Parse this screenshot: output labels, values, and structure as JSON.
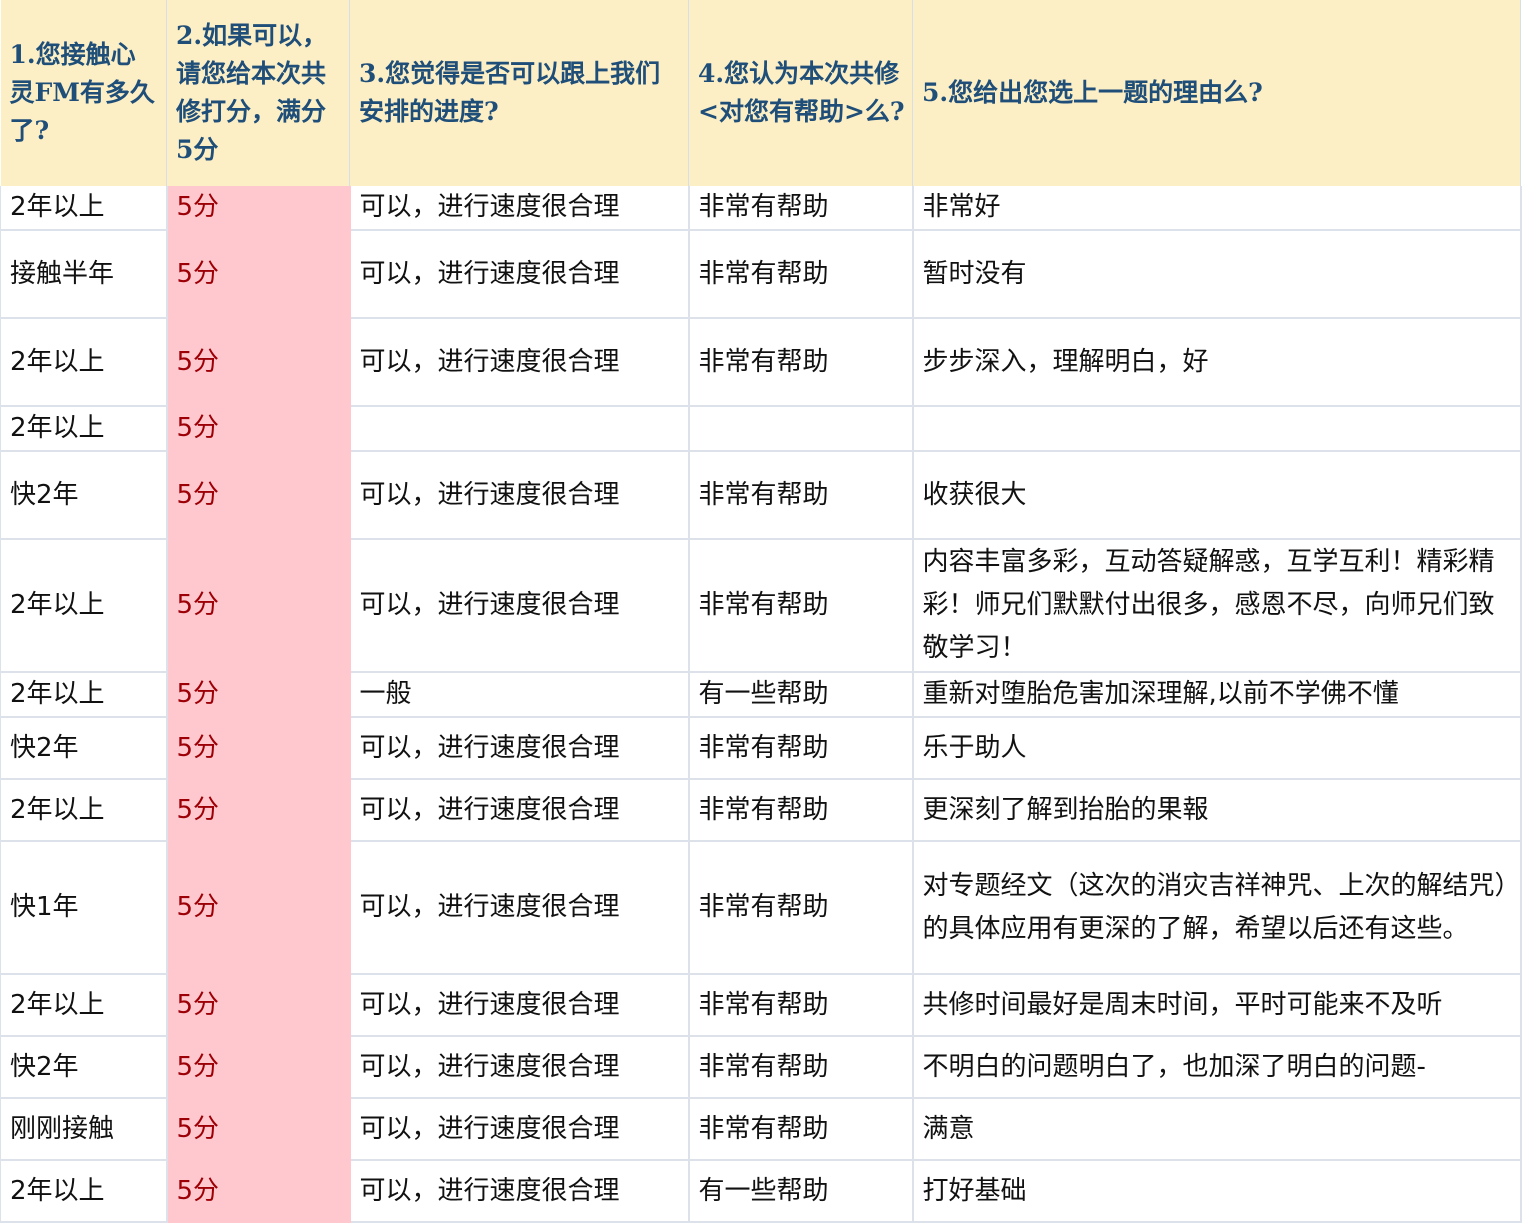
{
  "headers": [
    "1.您接触心灵FM有多久了?",
    "2.如果可以，请您给本次共修打分，满分5分",
    "3.您觉得是否可以跟上我们安排的进度?",
    "4.您认为本次共修<对您有帮助>么?",
    "5.您给出您选上一题的理由么?"
  ],
  "rows": [
    {
      "duration": "2年以上",
      "score": "5分",
      "pace": "可以，进行速度很合理",
      "helpful": "非常有帮助",
      "reason": "非常好"
    },
    {
      "duration": "接触半年",
      "score": "5分",
      "pace": "可以，进行速度很合理",
      "helpful": "非常有帮助",
      "reason": "暂时没有"
    },
    {
      "duration": "2年以上",
      "score": "5分",
      "pace": "可以，进行速度很合理",
      "helpful": "非常有帮助",
      "reason": "步步深入，理解明白，好"
    },
    {
      "duration": "2年以上",
      "score": "5分",
      "pace": "",
      "helpful": "",
      "reason": ""
    },
    {
      "duration": "快2年",
      "score": "5分",
      "pace": "可以，进行速度很合理",
      "helpful": "非常有帮助",
      "reason": "收获很大"
    },
    {
      "duration": "2年以上",
      "score": "5分",
      "pace": "可以，进行速度很合理",
      "helpful": "非常有帮助",
      "reason": "内容丰富多彩，互动答疑解惑，互学互利！精彩精彩！师兄们默默付出很多，感恩不尽，向师兄们致敬学习！"
    },
    {
      "duration": "2年以上",
      "score": "5分",
      "pace": "一般",
      "helpful": "有一些帮助",
      "reason": "重新对堕胎危害加深理解,以前不学佛不懂"
    },
    {
      "duration": "快2年",
      "score": "5分",
      "pace": "可以，进行速度很合理",
      "helpful": "非常有帮助",
      "reason": "乐于助人"
    },
    {
      "duration": "2年以上",
      "score": "5分",
      "pace": "可以，进行速度很合理",
      "helpful": "非常有帮助",
      "reason": "更深刻了解到抬胎的果報"
    },
    {
      "duration": "快1年",
      "score": "5分",
      "pace": "可以，进行速度很合理",
      "helpful": "非常有帮助",
      "reason": "对专题经文（这次的消灾吉祥神咒、上次的解结咒）的具体应用有更深的了解，希望以后还有这些。"
    },
    {
      "duration": "2年以上",
      "score": "5分",
      "pace": "可以，进行速度很合理",
      "helpful": "非常有帮助",
      "reason": "共修时间最好是周末时间，平时可能来不及听"
    },
    {
      "duration": "快2年",
      "score": "5分",
      "pace": "可以，进行速度很合理",
      "helpful": "非常有帮助",
      "reason": "不明白的问题明白了，也加深了明白的问题-"
    },
    {
      "duration": "刚刚接触",
      "score": "5分",
      "pace": "可以，进行速度很合理",
      "helpful": "非常有帮助",
      "reason": "满意"
    },
    {
      "duration": "2年以上",
      "score": "5分",
      "pace": "可以，进行速度很合理",
      "helpful": "有一些帮助",
      "reason": "打好基础"
    }
  ],
  "colors": {
    "header_bg": "#fcefc6",
    "header_text": "#1f4e79",
    "score_bg": "#ffc7ce",
    "score_text": "#9c0006",
    "grid": "#dde2ea"
  }
}
